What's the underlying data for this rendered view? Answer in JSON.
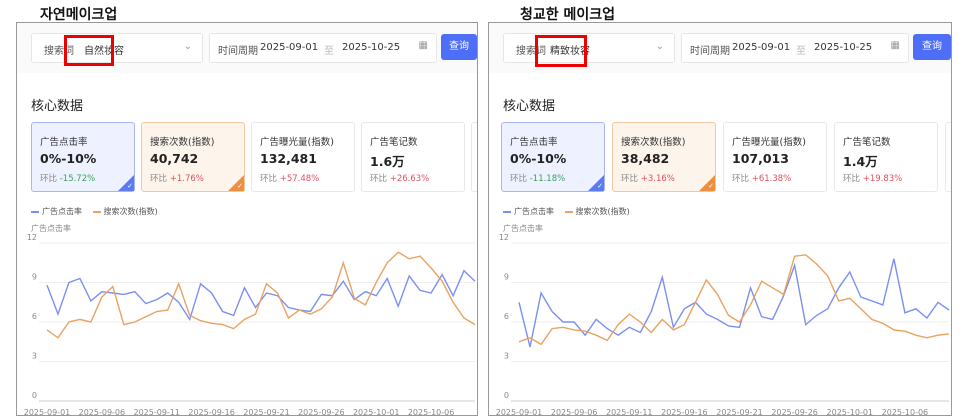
{
  "panels": [
    {
      "heading": "자연메이크업",
      "search_label": "搜索词",
      "search_value": "自然妆容",
      "period_label": "时间周期",
      "date_start": "2025-09-01",
      "date_sep": "至",
      "date_end": "2025-10-25",
      "query_button": "查询",
      "section_title": "核心数据",
      "cards": [
        {
          "title": "广告点击率",
          "value": "0%-10%",
          "delta_label": "环比",
          "delta": "-15.72%",
          "sign": "neg"
        },
        {
          "title": "搜索次数(指数)",
          "value": "40,742",
          "delta_label": "环比",
          "delta": "+1.76%",
          "sign": "pos"
        },
        {
          "title": "广告曝光量(指数)",
          "value": "132,481",
          "delta_label": "环比",
          "delta": "+57.48%",
          "sign": "pos"
        },
        {
          "title": "广告笔记数",
          "value": "1.6万",
          "delta_label": "环比",
          "delta": "+26.63%",
          "sign": "pos"
        }
      ],
      "legend": [
        "广告点击率",
        "搜索次数(指数)"
      ],
      "y_axis_name": "广告点击率",
      "chart_data": {
        "type": "line",
        "ylim": [
          0,
          12
        ],
        "yticks": [
          0,
          3,
          6,
          9,
          12
        ],
        "x_ticks": [
          "2025-09-01",
          "2025-09-06",
          "2025-09-11",
          "2025-09-16",
          "2025-09-21",
          "2025-09-26",
          "2025-10-01",
          "2025-10-06"
        ],
        "series": [
          {
            "name": "广告点击率",
            "color": "#7b8ff0",
            "values": [
              8.8,
              6.6,
              9.0,
              9.3,
              7.6,
              8.3,
              8.2,
              8.1,
              8.3,
              7.4,
              7.7,
              8.2,
              7.5,
              6.2,
              8.9,
              8.2,
              6.8,
              6.5,
              8.6,
              7.1,
              8.2,
              8.0,
              7.1,
              6.9,
              6.8,
              8.1,
              8.0,
              9.1,
              7.7,
              8.3,
              8.0,
              9.3,
              7.2,
              9.5,
              8.4,
              8.2,
              9.6,
              8.0,
              9.9,
              9.1
            ]
          },
          {
            "name": "搜索次数(指数)",
            "color": "#e9a25f",
            "values": [
              5.4,
              4.8,
              6.0,
              6.2,
              6.0,
              7.9,
              8.7,
              5.8,
              6.0,
              6.4,
              6.8,
              6.9,
              8.9,
              6.5,
              6.1,
              5.9,
              5.8,
              5.5,
              6.2,
              6.6,
              8.9,
              8.2,
              6.3,
              6.9,
              6.6,
              7.0,
              7.9,
              10.5,
              7.8,
              7.3,
              9.0,
              10.5,
              11.3,
              10.8,
              11.0,
              10.1,
              9.1,
              7.5,
              6.3,
              5.8
            ]
          }
        ]
      }
    },
    {
      "heading": "청교한 메이크업",
      "search_label": "搜索词",
      "search_value": "精致妆容",
      "period_label": "时间周期",
      "date_start": "2025-09-01",
      "date_sep": "至",
      "date_end": "2025-10-25",
      "query_button": "查询",
      "section_title": "核心数据",
      "cards": [
        {
          "title": "广告点击率",
          "value": "0%-10%",
          "delta_label": "环比",
          "delta": "-11.18%",
          "sign": "neg"
        },
        {
          "title": "搜索次数(指数)",
          "value": "38,482",
          "delta_label": "环比",
          "delta": "+3.16%",
          "sign": "pos"
        },
        {
          "title": "广告曝光量(指数)",
          "value": "107,013",
          "delta_label": "环比",
          "delta": "+61.38%",
          "sign": "pos"
        },
        {
          "title": "广告笔记数",
          "value": "1.4万",
          "delta_label": "环比",
          "delta": "+19.83%",
          "sign": "pos"
        }
      ],
      "legend": [
        "广告点击率",
        "搜索次数(指数)"
      ],
      "y_axis_name": "广告点击率",
      "chart_data": {
        "type": "line",
        "ylim": [
          0,
          12
        ],
        "yticks": [
          0,
          3,
          6,
          9,
          12
        ],
        "x_ticks": [
          "2025-09-01",
          "2025-09-06",
          "2025-09-11",
          "2025-09-16",
          "2025-09-21",
          "2025-09-26",
          "2025-10-01",
          "2025-10-06"
        ],
        "series": [
          {
            "name": "广告点击率",
            "color": "#7b8ff0",
            "values": [
              7.5,
              4.1,
              8.2,
              6.8,
              6.0,
              6.0,
              5.0,
              6.2,
              5.5,
              5.0,
              5.6,
              5.2,
              6.8,
              9.4,
              5.6,
              7.0,
              7.5,
              6.6,
              6.2,
              5.7,
              5.6,
              8.6,
              6.4,
              6.2,
              8.0,
              10.3,
              5.8,
              6.5,
              7.0,
              8.6,
              9.8,
              7.9,
              7.6,
              7.3,
              10.8,
              6.7,
              7.0,
              6.3,
              7.5,
              6.9
            ]
          },
          {
            "name": "搜索次数(指数)",
            "color": "#e9a25f",
            "values": [
              4.5,
              4.8,
              4.3,
              5.5,
              5.6,
              5.4,
              5.3,
              5.0,
              4.6,
              5.8,
              6.6,
              6.0,
              5.2,
              6.2,
              5.4,
              5.8,
              7.5,
              9.2,
              8.1,
              6.5,
              6.0,
              7.3,
              9.1,
              8.6,
              8.1,
              11.0,
              11.1,
              10.4,
              9.5,
              7.6,
              7.8,
              7.0,
              6.2,
              5.9,
              5.4,
              5.3,
              5.0,
              4.8,
              5.0,
              5.1
            ]
          }
        ]
      }
    }
  ]
}
